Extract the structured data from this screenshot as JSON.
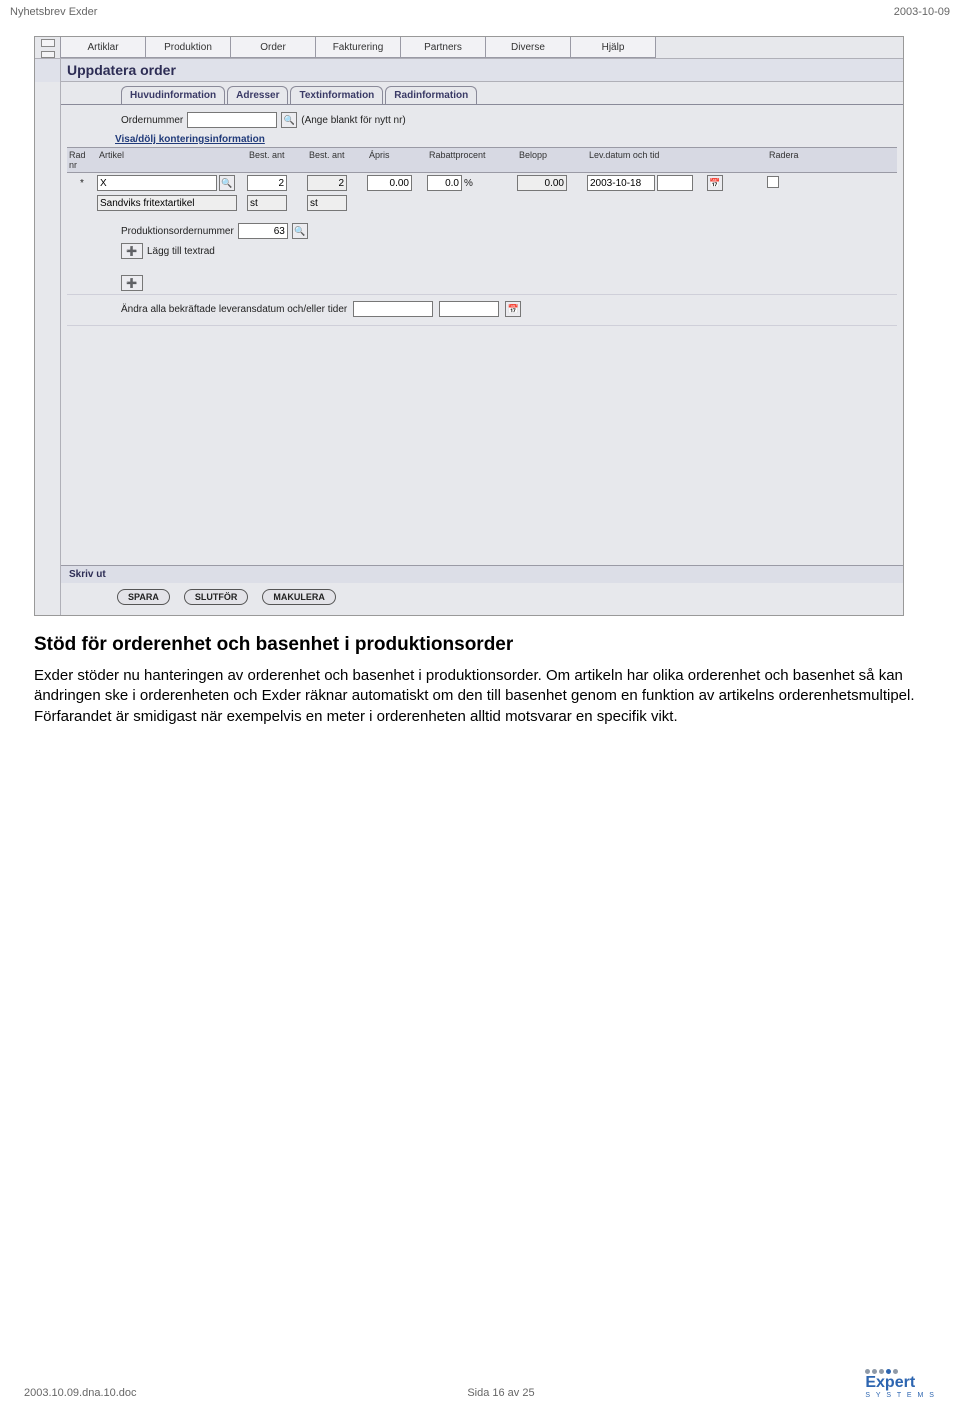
{
  "page_header": {
    "left": "Nyhetsbrev Exder",
    "right": "2003-10-09"
  },
  "app": {
    "menu": [
      "Artiklar",
      "Produktion",
      "Order",
      "Fakturering",
      "Partners",
      "Diverse",
      "Hjälp"
    ],
    "title": "Uppdatera order",
    "subtabs": [
      "Huvudinformation",
      "Adresser",
      "Textinformation",
      "Radinformation"
    ],
    "active_subtab": 3,
    "ordernr_label": "Ordernummer",
    "ordernr_value": "",
    "ordernr_hint": "(Ange blankt för nytt nr)",
    "konto_link": "Visa/dölj konteringsinformation",
    "grid": {
      "headers": [
        "Rad nr",
        "Artikel",
        "Best. ant",
        "Best. ant",
        "Ápris",
        "Rabattprocent",
        "Belopp",
        "Lev.datum och tid",
        "",
        "Radera"
      ],
      "row1": {
        "radnr": "*",
        "artikel": "X",
        "best1": "2",
        "best2": "2",
        "apris": "0.00",
        "rabatt": "0.0",
        "rabatt_unit": "%",
        "belopp": "0.00",
        "levdatum": "2003-10-18"
      },
      "row2": {
        "artikel": "Sandviks fritextartikel",
        "unit1": "st",
        "unit2": "st"
      }
    },
    "prodorder_label": "Produktionsordernummer",
    "prodorder_value": "63",
    "add_textrow": "Lägg till textrad",
    "change_all_label": "Ändra alla bekräftade leveransdatum och/eller tider",
    "skrivut": "Skriv ut",
    "buttons": [
      "SPARA",
      "SLUTFÖR",
      "MAKULERA"
    ]
  },
  "article": {
    "heading": "Stöd för orderenhet och basenhet i produktionsorder",
    "body": "Exder stöder nu hanteringen av orderenhet och basenhet i produktionsorder. Om artikeln har olika orderenhet och basenhet så kan ändringen ske i orderenheten och Exder räknar automatiskt om den till basenhet genom en funktion av artikelns orderenhetsmultipel. Förfarandet är smidigast när exempelvis en meter i orderenheten alltid motsvarar en specifik vikt."
  },
  "page_footer": {
    "left": "2003.10.09.dna.10.doc",
    "center": "Sida 16 av 25",
    "logo_main": "Expert",
    "logo_sub": "S Y S T E M S"
  }
}
